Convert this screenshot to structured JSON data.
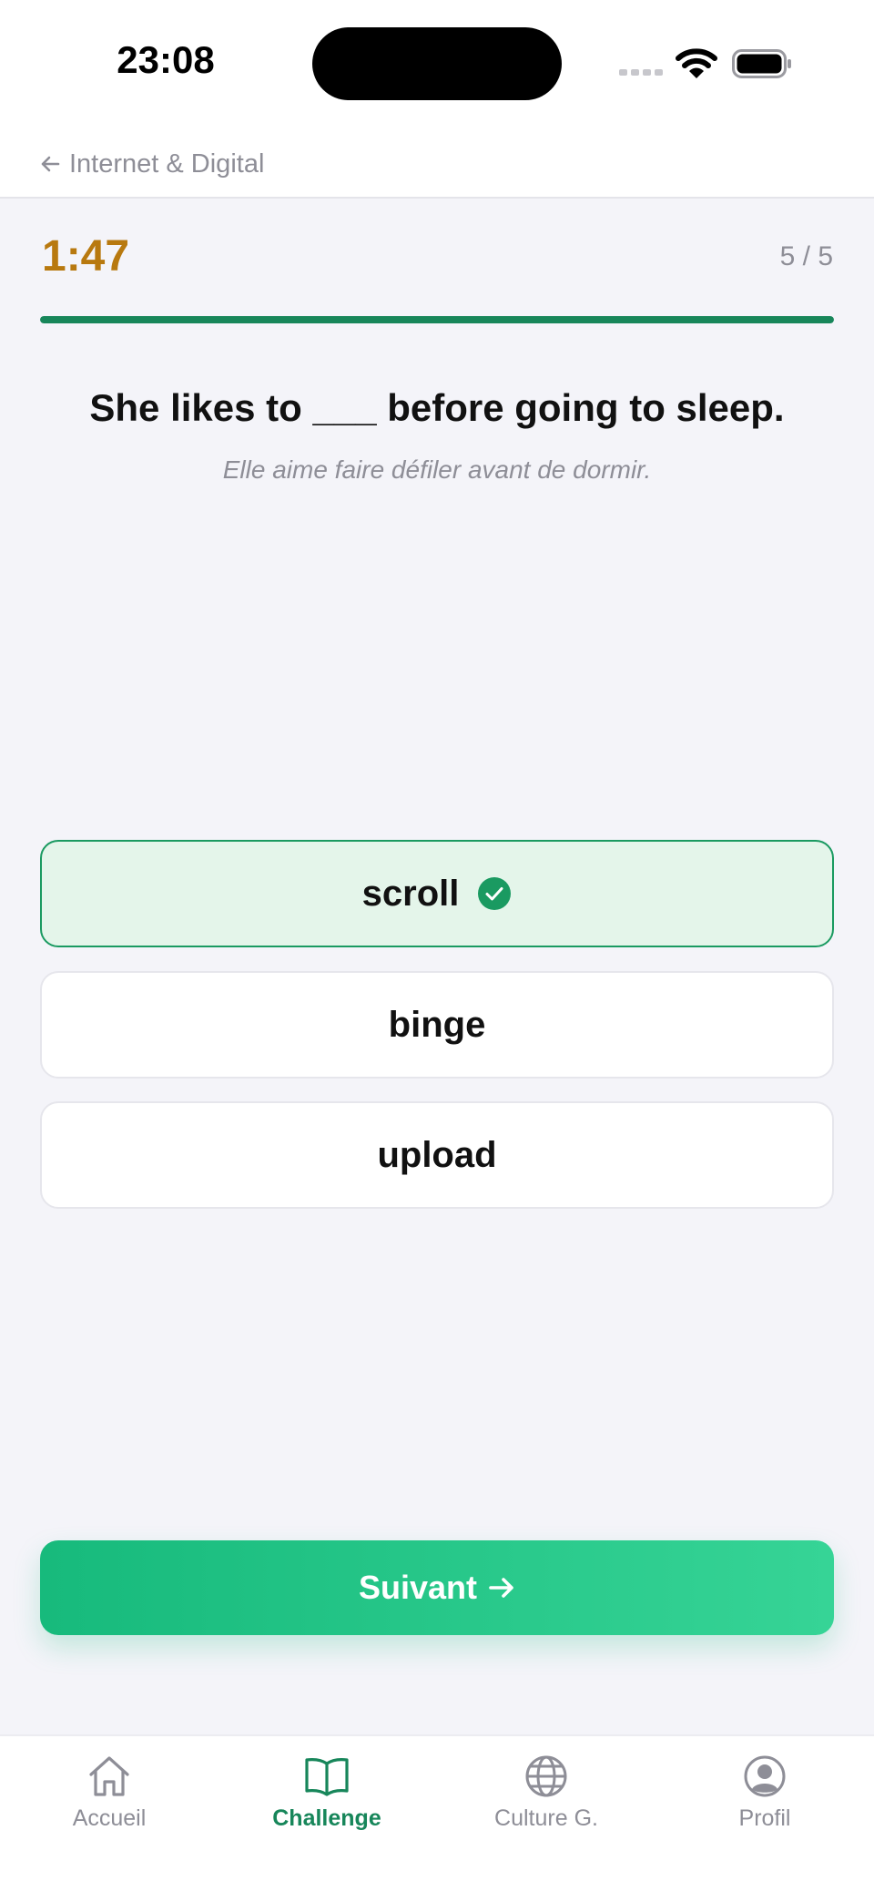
{
  "status_bar": {
    "time": "23:08"
  },
  "header": {
    "back_label": "Internet & Digital"
  },
  "quiz": {
    "timer": "1:47",
    "counter": "5 / 5",
    "progress": 1.0,
    "question": "She likes to ___ before going to sleep.",
    "translation": "Elle aime faire défiler avant de dormir.",
    "options": [
      {
        "label": "scroll",
        "state": "correct"
      },
      {
        "label": "binge",
        "state": "default"
      },
      {
        "label": "upload",
        "state": "default"
      }
    ],
    "next_label": "Suivant"
  },
  "tab_bar": {
    "tabs": [
      {
        "label": "Accueil",
        "icon": "home-icon",
        "active": false
      },
      {
        "label": "Challenge",
        "icon": "book-icon",
        "active": true
      },
      {
        "label": "Culture G.",
        "icon": "globe-icon",
        "active": false
      },
      {
        "label": "Profil",
        "icon": "profile-icon",
        "active": false
      }
    ]
  },
  "colors": {
    "accent": "#17865a",
    "timer": "#b8790f",
    "correct_bg": "#e4f5ea",
    "correct_border": "#1a9a61",
    "button_gradient_start": "#17ba7c",
    "button_gradient_end": "#36d496"
  }
}
